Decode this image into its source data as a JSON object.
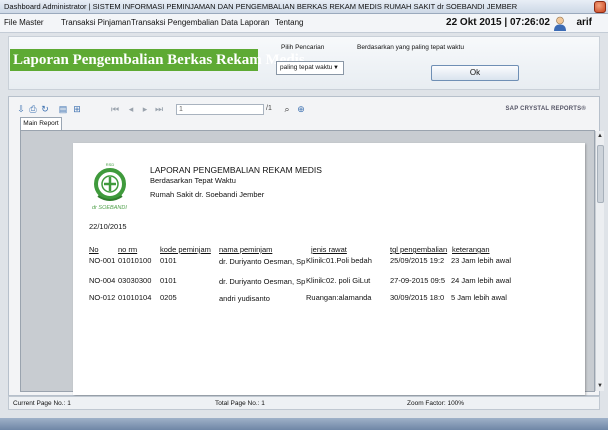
{
  "window": {
    "title": "Dashboard Administrator | SISTEM INFORMASI PEMINJAMAN DAN PENGEMBALIAN BERKAS REKAM MEDIS RUMAH SAKIT dr SOEBANDI JEMBER"
  },
  "menu": {
    "items": [
      "File Master",
      "Transaksi Pinjaman",
      "Transaksi Pengembalian",
      "Data Laporan",
      "Tentang"
    ],
    "datetime": "22 Okt 2015 | 07:26:02",
    "user": "arif"
  },
  "header": {
    "title": "Laporan Pengembalian Berkas Rekam Medis",
    "pilih_label": "Pilih Pencarian",
    "pilih_value": "paling tepat waktu",
    "cari_label": "Berdasarkan yang paling tepat waktu",
    "ok_label": "Ok"
  },
  "viewer": {
    "page_value": "1",
    "page_of": "/1",
    "brand": "SAP CRYSTAL REPORTS®",
    "tab": "Main Report"
  },
  "report": {
    "logo_top": "RSD",
    "logo_text": "dr SOEBANDI",
    "line1": "LAPORAN PENGEMBALIAN REKAM MEDIS",
    "line2": "Berdasarkan Tepat Waktu",
    "line3": "Rumah Sakit dr. Soebandi Jember",
    "date": "22/10/2015",
    "columns": [
      "No",
      "no rm",
      "kode peminjam",
      "nama peminjam",
      "jenis rawat",
      "tgl pengembalian",
      "keterangan"
    ],
    "rows": [
      [
        "NO-001",
        "01010100",
        "0101",
        "dr. Duriyanto Oesman, Sp",
        "Klinik:01.Poli bedah",
        "25/09/2015 19:2",
        "23 Jam lebih awal"
      ],
      [
        "NO-004",
        "03030300",
        "0101",
        "dr. Duriyanto Oesman, Sp",
        "Klinik:02. poli GiLut",
        "27-09-2015 09:5",
        "24 Jam lebih awal"
      ],
      [
        "NO-012",
        "01010104",
        "0205",
        "andri yudisanto",
        "Ruangan:alamanda",
        "30/09/2015 18:0",
        "5 Jam lebih awal"
      ]
    ]
  },
  "status": {
    "current_page": "Current Page No.: 1",
    "total_page": "Total Page No.: 1",
    "zoom": "Zoom Factor: 100%"
  },
  "colors": {
    "title_green": "#5eaa34",
    "logo_green": "#3f9a3c"
  }
}
